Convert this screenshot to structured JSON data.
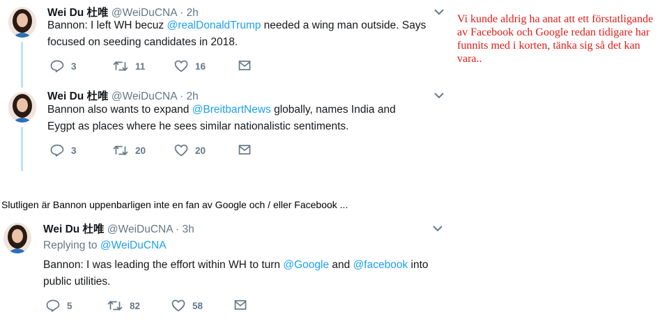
{
  "tweets": [
    {
      "name": "Wei Du 杜唯",
      "handle": "@WeiDuCNA · 2h",
      "line1_pre": "Bannon: I left WH becuz ",
      "line1_mention": "@realDonaldTrump",
      "line1_post": " needed a wing man outside. Says",
      "line2": "focused on seeding candidates in 2018.",
      "replies": "3",
      "retweets": "11",
      "likes": "16"
    },
    {
      "name": "Wei Du 杜唯",
      "handle": "@WeiDuCNA · 2h",
      "line1_pre": "Bannon also wants to expand ",
      "line1_mention": "@BreitbartNews",
      "line1_post": " globally, names India and",
      "line2": "Eygpt as places where he sees similar nationalistic sentiments.",
      "replies": "3",
      "retweets": "20",
      "likes": "20"
    },
    {
      "name": "Wei Du 杜唯",
      "handle": "@WeiDuCNA · 3h",
      "replying_label": "Replying to ",
      "replying_mention": "@WeiDuCNA",
      "line1_pre": "Bannon: I was leading the effort within WH to turn ",
      "line1_mention": "@Google",
      "line1_mid": " and ",
      "line1_mention2": "@facebook",
      "line1_post": " into",
      "line2": "public utilities.",
      "replies": "5",
      "retweets": "82",
      "likes": "58"
    }
  ],
  "caption": "Slutligen är Bannon uppenbarligen inte en fan av Google och / eller Facebook ...",
  "note": "Vi kunde aldrig ha anat att ett förstatligande av Facebook och Google redan tidigare har funnits med i korten, tänka sig så det kan vara..",
  "colors": {
    "mention": "#1da1f2",
    "muted": "#657786",
    "thread_line": "#bfe0f3",
    "note": "#e41b17"
  }
}
